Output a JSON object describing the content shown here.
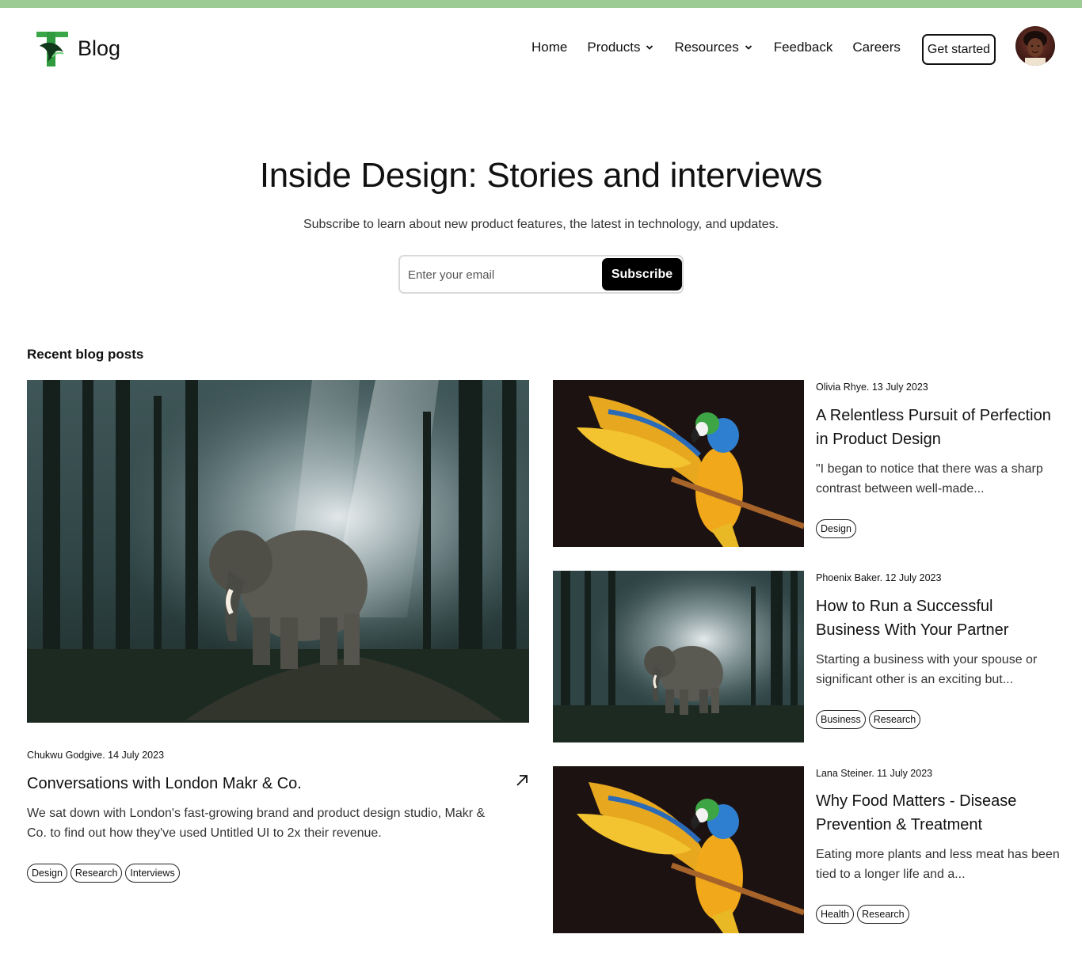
{
  "header": {
    "brand": "Blog",
    "nav": [
      {
        "label": "Home",
        "dropdown": false
      },
      {
        "label": "Products",
        "dropdown": true
      },
      {
        "label": "Resources",
        "dropdown": true
      },
      {
        "label": "Feedback",
        "dropdown": false
      },
      {
        "label": "Careers",
        "dropdown": false
      }
    ],
    "cta": "Get started"
  },
  "hero": {
    "title": "Inside Design: Stories and interviews",
    "subtitle": "Subscribe to learn about new product features, the latest in technology, and updates.",
    "email_placeholder": "Enter your email",
    "subscribe_label": "Subscribe"
  },
  "section_title": "Recent blog posts",
  "featured": {
    "image": "elephant-forest",
    "meta": "Chukwu Godgive. 14 July 2023",
    "title": "Conversations with London Makr & Co.",
    "description": "We sat down with London's fast-growing brand and product design studio, Makr & Co. to find out how they've used Untitled UI to 2x their revenue.",
    "tags": [
      "Design",
      "Research",
      "Interviews"
    ]
  },
  "posts": [
    {
      "image": "parrot",
      "meta": "Olivia Rhye. 13 July 2023",
      "title": "A Relentless Pursuit of Perfection in Product Design",
      "description": "\"I began to notice that there was a sharp contrast between well-made...",
      "tags": [
        "Design"
      ]
    },
    {
      "image": "elephant-forest",
      "meta": "Phoenix Baker. 12 July 2023",
      "title": "How to Run a Successful Business With Your Partner",
      "description": "Starting a business with your spouse or significant other is an exciting but...",
      "tags": [
        "Business",
        "Research"
      ]
    },
    {
      "image": "parrot",
      "meta": "Lana Steiner. 11 July 2023",
      "title": "Why Food Matters - Disease Prevention & Treatment",
      "description": "Eating more plants and less meat has been tied to a longer life and a...",
      "tags": [
        "Health",
        "Research"
      ]
    }
  ],
  "colors": {
    "top_stripe": "#9ccb94",
    "logo_green": "#2ea043",
    "button_dark": "#000000"
  }
}
